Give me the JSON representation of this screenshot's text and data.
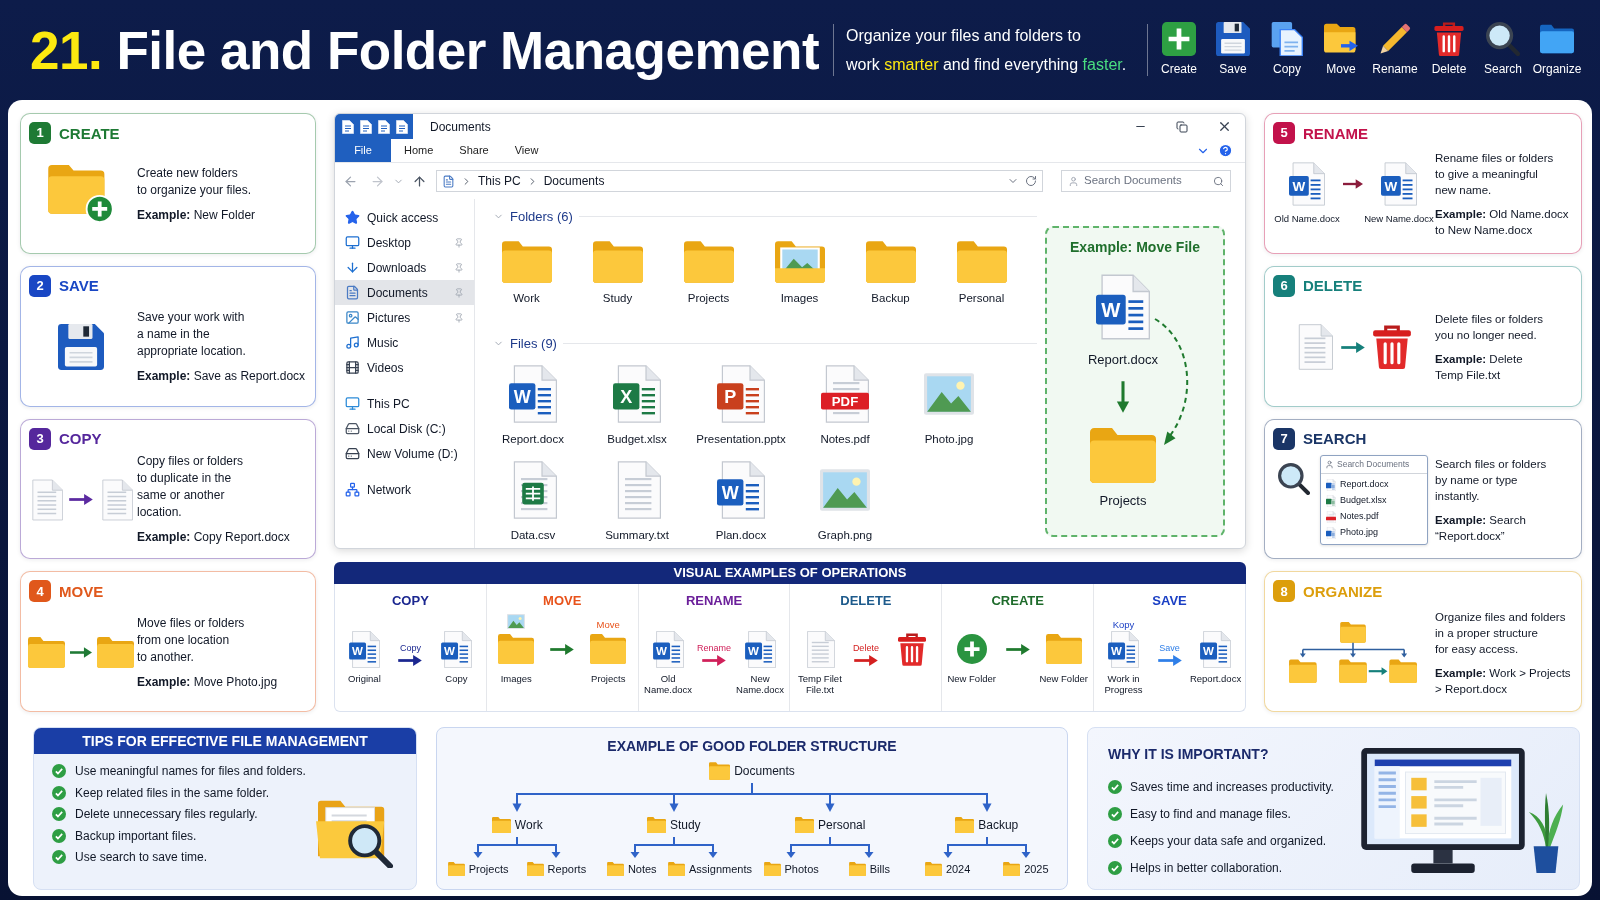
{
  "header": {
    "number": "21.",
    "title": "File and Folder Management",
    "tagline": [
      [
        {
          "text": "Organize your files and folders to"
        }
      ],
      [
        {
          "text": "work "
        },
        {
          "text": "smarter",
          "color": "#fde910"
        },
        {
          "text": " and find everything "
        },
        {
          "text": "faster",
          "color": "#4ade80"
        },
        {
          "text": "."
        }
      ]
    ]
  },
  "toolbar": [
    {
      "label": "Create",
      "kind": "create"
    },
    {
      "label": "Save",
      "kind": "save"
    },
    {
      "label": "Copy",
      "kind": "copy"
    },
    {
      "label": "Move",
      "kind": "move"
    },
    {
      "label": "Rename",
      "kind": "rename"
    },
    {
      "label": "Delete",
      "kind": "delete"
    },
    {
      "label": "Search",
      "kind": "search"
    },
    {
      "label": "Organize",
      "kind": "organize"
    }
  ],
  "left_cards": [
    {
      "number": "1",
      "title": "CREATE",
      "color": "#1e7a34",
      "kind": "create",
      "description": "Create new folders\nto organize your files.",
      "example": "**Example:** New Folder"
    },
    {
      "number": "2",
      "title": "SAVE",
      "color": "#1947c4",
      "kind": "save",
      "description": "Save your work with\na name in the\nappropriate location.",
      "example": "**Example:** Save as Report.docx"
    },
    {
      "number": "3",
      "title": "COPY",
      "color": "#55279c",
      "kind": "copy",
      "description": "Copy files or folders\nto duplicate in the\nsame or another\nlocation.",
      "example": "**Example:** Copy Report.docx"
    },
    {
      "number": "4",
      "title": "MOVE",
      "color": "#e0581b",
      "kind": "move",
      "description": "Move files or folders\nfrom one location\nto another.",
      "example": "**Example:** Move Photo.jpg"
    }
  ],
  "explorer": {
    "title": "Documents",
    "ribbon_tabs": [
      {
        "label": "File",
        "selected": true
      },
      {
        "label": "Home",
        "selected": false
      },
      {
        "label": "Share",
        "selected": false
      },
      {
        "label": "View",
        "selected": false
      }
    ],
    "path": [
      "This PC",
      "Documents"
    ],
    "search_placeholder": "Search Documents",
    "nav_sections": [
      {
        "items": [
          {
            "label": "Quick access",
            "kind": "star",
            "pinned": false,
            "selected": false
          },
          {
            "label": "Desktop",
            "kind": "desktop",
            "pinned": true,
            "selected": false
          },
          {
            "label": "Downloads",
            "kind": "downloads",
            "pinned": true,
            "selected": false
          },
          {
            "label": "Documents",
            "kind": "documents",
            "pinned": true,
            "selected": true
          },
          {
            "label": "Pictures",
            "kind": "pictures",
            "pinned": true,
            "selected": false
          },
          {
            "label": "Music",
            "kind": "music",
            "pinned": false,
            "selected": false
          },
          {
            "label": "Videos",
            "kind": "videos",
            "pinned": false,
            "selected": false
          }
        ]
      },
      {
        "items": [
          {
            "label": "This PC",
            "kind": "computer",
            "pinned": false,
            "selected": false
          },
          {
            "label": "Local Disk (C:)",
            "kind": "disk",
            "pinned": false,
            "selected": false
          },
          {
            "label": "New Volume (D:)",
            "kind": "drive",
            "pinned": false,
            "selected": false
          }
        ]
      },
      {
        "items": [
          {
            "label": "Network",
            "kind": "network",
            "pinned": false,
            "selected": false
          }
        ]
      }
    ],
    "folders_heading": "Folders (6)",
    "folders": [
      {
        "name": "Work",
        "kind": "plain"
      },
      {
        "name": "Study",
        "kind": "plain"
      },
      {
        "name": "Projects",
        "kind": "plain"
      },
      {
        "name": "Images",
        "kind": "photo"
      },
      {
        "name": "Backup",
        "kind": "plain"
      },
      {
        "name": "Personal",
        "kind": "plain"
      }
    ],
    "files_heading": "Files (9)",
    "files": [
      {
        "name": "Report.docx",
        "kind": "word",
        "badge": "W"
      },
      {
        "name": "Budget.xlsx",
        "kind": "excel",
        "badge": "X"
      },
      {
        "name": "Presentation.pptx",
        "kind": "powerpoint",
        "badge": "P"
      },
      {
        "name": "Notes.pdf",
        "kind": "pdf",
        "badge": "PDF"
      },
      {
        "name": "Photo.jpg",
        "kind": "image"
      },
      {
        "name": "Data.csv",
        "kind": "csv"
      },
      {
        "name": "Summary.txt",
        "kind": "text"
      },
      {
        "name": "Plan.docx",
        "kind": "word",
        "badge": "W"
      },
      {
        "name": "Graph.png",
        "kind": "image"
      }
    ],
    "move_example": {
      "title": "Example: Move File",
      "file": {
        "name": "Report.docx",
        "kind": "word",
        "badge": "W"
      },
      "folder": "Projects"
    }
  },
  "visual_examples": {
    "title": "VISUAL EXAMPLES OF OPERATIONS",
    "panels": [
      {
        "title": "COPY",
        "color": "#1b2790",
        "from": {
          "kind": "word",
          "badge": "W",
          "label": "Original"
        },
        "arrow": {
          "label": "Copy",
          "color": "#1b2790"
        },
        "to": {
          "kind": "word",
          "badge": "W",
          "label": "Copy"
        }
      },
      {
        "title": "MOVE",
        "color": "#e8521a",
        "from": {
          "kind": "photo_folder",
          "label": "Images"
        },
        "arrow": {
          "color": "#1f7a2e"
        },
        "to": {
          "kind": "folder",
          "label": "Projects",
          "caption": "Move"
        }
      },
      {
        "title": "RENAME",
        "color": "#6b1f9a",
        "from": {
          "kind": "word",
          "badge": "W",
          "label": "Old Name.docx"
        },
        "arrow": {
          "label": "Rename",
          "color": "#d0205a"
        },
        "to": {
          "kind": "word",
          "badge": "W",
          "label": "New Name.docx"
        }
      },
      {
        "title": "DELETE",
        "color": "#1e5b8c",
        "from": {
          "kind": "text",
          "label": "Temp Filet File.txt"
        },
        "arrow": {
          "label": "Delete",
          "color": "#d42020"
        },
        "to": {
          "kind": "trash"
        }
      },
      {
        "title": "CREATE",
        "color": "#1e6b2b",
        "from": {
          "kind": "plus",
          "label": "New Folder"
        },
        "arrow": {
          "color": "#1f7a2e"
        },
        "to": {
          "kind": "folder",
          "label": "New Folder"
        }
      },
      {
        "title": "SAVE",
        "color": "#1a3fc4",
        "from": {
          "kind": "word",
          "badge": "W",
          "label": "Work in Progress",
          "caption": "Kopy"
        },
        "arrow": {
          "label": "Save",
          "color": "#2f7fe8"
        },
        "to": {
          "kind": "word",
          "badge": "W",
          "label": "Report.docx"
        }
      }
    ]
  },
  "right_cards": [
    {
      "number": "5",
      "title": "RENAME",
      "color": "#c2124b",
      "kind": "rename",
      "files": [
        {
          "label": "Old Name.docx",
          "badge": "W"
        },
        {
          "label": "New Name.docx",
          "badge": "W"
        }
      ],
      "description": "Rename files or folders\nto give a meaningful\nnew name.",
      "example": "**Example:** Old Name.docx\nto New Name.docx"
    },
    {
      "number": "6",
      "title": "DELETE",
      "color": "#16807b",
      "kind": "delete",
      "description": "Delete files or folders\nyou no longer need.",
      "example": "**Example:** Delete\nTemp File.txt"
    },
    {
      "number": "7",
      "title": "SEARCH",
      "color": "#1a3566",
      "kind": "search",
      "search_box": {
        "placeholder": "Search Documents",
        "results": [
          {
            "name": "Report.docx",
            "kind": "word"
          },
          {
            "name": "Budget.xlsx",
            "kind": "excel"
          },
          {
            "name": "Notes.pdf",
            "kind": "pdf"
          },
          {
            "name": "Photo.jpg",
            "kind": "word"
          }
        ]
      },
      "description": "Search files or folders\nby name or type\ninstantly.",
      "example": "**Example:** Search\n“Report.docx”"
    },
    {
      "number": "8",
      "title": "ORGANIZE",
      "color": "#dc9e0c",
      "kind": "organize",
      "description": "Organize files and folders\nin a proper structure\nfor easy access.",
      "example": "**Example:** Work > Projects\n> Report.docx"
    }
  ],
  "tips": {
    "title": "TIPS FOR EFFECTIVE FILE MANAGEMENT",
    "items": [
      "Use meaningful names for files and folders.",
      "Keep related files in the same folder.",
      "Delete unnecessary files regularly.",
      "Backup important files.",
      "Use search to save time."
    ]
  },
  "folder_structure": {
    "title": "EXAMPLE OF GOOD FOLDER STRUCTURE",
    "tree": {
      "name": "Documents",
      "children": [
        {
          "name": "Work",
          "children": [
            {
              "name": "Projects"
            },
            {
              "name": "Reports"
            }
          ]
        },
        {
          "name": "Study",
          "children": [
            {
              "name": "Notes"
            },
            {
              "name": "Assignments"
            }
          ]
        },
        {
          "name": "Personal",
          "children": [
            {
              "name": "Photos"
            },
            {
              "name": "Bills"
            }
          ]
        },
        {
          "name": "Backup",
          "children": [
            {
              "name": "2024"
            },
            {
              "name": "2025"
            }
          ]
        }
      ]
    }
  },
  "importance": {
    "title": "WHY IT IS IMPORTANT?",
    "items": [
      "Saves time and increases productivity.",
      "Easy to find and manage files.",
      "Keeps your data safe and organized.",
      "Helps in better collaboration."
    ]
  }
}
